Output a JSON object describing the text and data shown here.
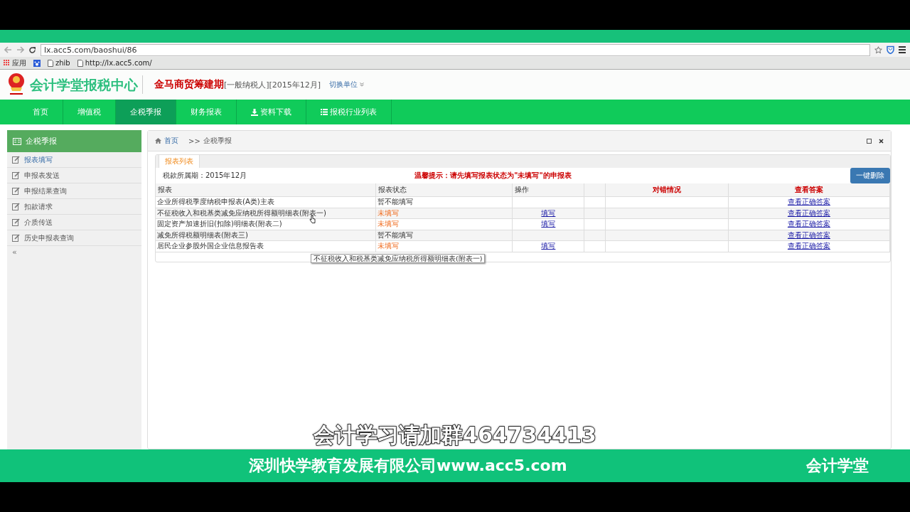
{
  "browser": {
    "url": "lx.acc5.com/baoshui/86",
    "bookmarks": [
      {
        "kind": "apps",
        "label": "应用"
      },
      {
        "kind": "paw"
      },
      {
        "kind": "page",
        "label": "zhib"
      },
      {
        "kind": "page",
        "label": "http://lx.acc5.com/"
      }
    ]
  },
  "header": {
    "logo_text": "会计学堂报税中心",
    "company": "金马商贸筹建期",
    "info": "[一般纳税人][2015年12月]",
    "switch_unit": "切换单位"
  },
  "nav": [
    {
      "label": "首页",
      "kind": "plain",
      "selected": false
    },
    {
      "label": "增值税",
      "kind": "plain",
      "selected": false
    },
    {
      "label": "企税季报",
      "kind": "plain",
      "selected": true
    },
    {
      "label": "财务报表",
      "kind": "plain",
      "selected": false
    },
    {
      "label": "资料下载",
      "kind": "download",
      "selected": false
    },
    {
      "label": "报税行业列表",
      "kind": "list",
      "selected": false
    }
  ],
  "sidebar": {
    "title": "企税季报",
    "items": [
      {
        "label": "报表填写",
        "selected": true
      },
      {
        "label": "申报表发送",
        "selected": false
      },
      {
        "label": "申报结果查询",
        "selected": false
      },
      {
        "label": "扣款请求",
        "selected": false
      },
      {
        "label": "介质传送",
        "selected": false
      },
      {
        "label": "历史申报表查询",
        "selected": false
      }
    ],
    "collapse": "«"
  },
  "panel": {
    "breadcrumb": {
      "home": "首页",
      "separator": ">>",
      "current": "企税季报"
    },
    "tabs": [
      {
        "label": "报表列表",
        "selected": true
      }
    ],
    "period": "税款所属期：2015年12月",
    "notice": "温馨提示：请先填写报表状态为\"未填写\"的申报表",
    "delete_button": "一键删除",
    "table": {
      "columns": [
        {
          "label": "报表",
          "kind": "normal"
        },
        {
          "label": "报表状态",
          "kind": "normal"
        },
        {
          "label": "操作",
          "kind": "normal"
        },
        {
          "kind": "normal"
        },
        {
          "label": "对错情况",
          "kind": "red"
        },
        {
          "label": "查看答案",
          "kind": "red"
        }
      ],
      "rows": [
        {
          "name": "企业所得税季度纳税申报表(A类)主表",
          "status": "暂不能填写",
          "kind": "blocked",
          "answer": "查看正确答案"
        },
        {
          "name": "不征税收入和税基类减免应纳税所得额明细表(附表一)",
          "status": "未填写",
          "kind": "pending",
          "action": "填写",
          "answer": "查看正确答案"
        },
        {
          "name": "固定资产加速折旧(扣除)明细表(附表二)",
          "status": "未填写",
          "kind": "pending",
          "action": "填写",
          "answer": "查看正确答案"
        },
        {
          "name": "减免所得税额明细表(附表三)",
          "status": "暂不能填写",
          "kind": "blocked",
          "answer": "查看正确答案"
        },
        {
          "name": "居民企业参股外国企业信息报告表",
          "status": "未填写",
          "kind": "pending",
          "action": "填写",
          "answer": "查看正确答案"
        }
      ]
    },
    "tooltip": "不征税收入和税基类减免应纳税所得额明细表(附表一)"
  },
  "overlay": {
    "caption": "会计学习请加群464734413",
    "banner_left": "深圳快学教育发展有限公司www.acc5.com",
    "banner_right": "会计学堂"
  }
}
